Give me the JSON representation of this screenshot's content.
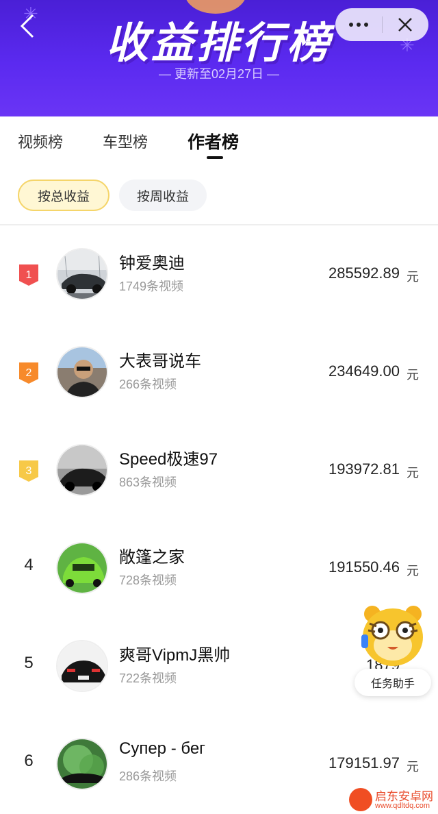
{
  "header": {
    "title": "收益排行榜",
    "subtitle": "— 更新至02月27日 —",
    "back_icon": "chevron-left-icon",
    "more_icon": "more-dots-icon",
    "close_icon": "close-icon"
  },
  "tabs": [
    {
      "label": "视频榜",
      "active": false
    },
    {
      "label": "车型榜",
      "active": false
    },
    {
      "label": "作者榜",
      "active": true
    }
  ],
  "filters": [
    {
      "label": "按总收益",
      "active": true
    },
    {
      "label": "按周收益",
      "active": false
    }
  ],
  "ranking": [
    {
      "rank": "1",
      "name": "钟爱奥迪",
      "videos": "1749条视频",
      "amount": "285592.89",
      "unit": "元",
      "badge_color": "#f05050"
    },
    {
      "rank": "2",
      "name": "大表哥说车",
      "videos": "266条视频",
      "amount": "234649.00",
      "unit": "元",
      "badge_color": "#f78a2b"
    },
    {
      "rank": "3",
      "name": "Speed极速97",
      "videos": "863条视频",
      "amount": "193972.81",
      "unit": "元",
      "badge_color": "#f7c948"
    },
    {
      "rank": "4",
      "name": "敞篷之家",
      "videos": "728条视频",
      "amount": "191550.46",
      "unit": "元"
    },
    {
      "rank": "5",
      "name": "爽哥VipmJ黑帅",
      "videos": "722条视频",
      "amount": "1879",
      "unit": ""
    },
    {
      "rank": "6",
      "name": "Супер - бег",
      "videos": "286条视频",
      "amount": "179151.97",
      "unit": "元"
    }
  ],
  "helper": {
    "label": "任务助手",
    "icon": "tiger-mascot-icon"
  },
  "watermark": {
    "text": "启东安卓网",
    "url": "www.qdltdq.com"
  },
  "colors": {
    "banner": "#5b2af0",
    "active_chip_bg": "#fff7d4",
    "active_chip_border": "#f5d56a"
  }
}
